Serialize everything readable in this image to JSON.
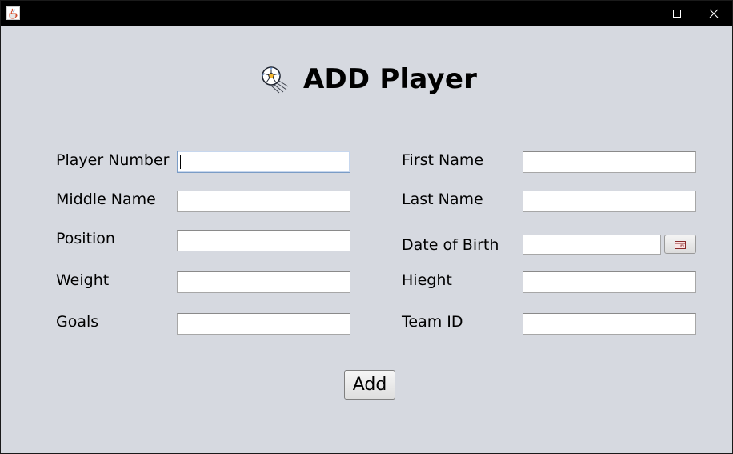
{
  "window": {
    "icons": {
      "app": "java-cup-icon",
      "minimize": "minimize-icon",
      "maximize": "maximize-icon",
      "close": "close-icon"
    }
  },
  "header": {
    "icon": "soccer-ball-icon",
    "title": "ADD Player"
  },
  "form": {
    "player_number": {
      "label": "Player Number",
      "value": ""
    },
    "first_name": {
      "label": "First Name",
      "value": ""
    },
    "middle_name": {
      "label": "Middle Name",
      "value": ""
    },
    "last_name": {
      "label": "Last Name",
      "value": ""
    },
    "position": {
      "label": "Position",
      "value": ""
    },
    "date_of_birth": {
      "label": "Date of Birth",
      "value": "",
      "button_icon": "calendar-icon"
    },
    "weight": {
      "label": "Weight",
      "value": ""
    },
    "height": {
      "label": "Hieght",
      "value": ""
    },
    "goals": {
      "label": "Goals",
      "value": ""
    },
    "team_id": {
      "label": "Team ID",
      "value": ""
    }
  },
  "actions": {
    "add_label": "Add"
  },
  "colors": {
    "background": "#d6d9e0",
    "titlebar": "#000000",
    "focus_border": "#7a9cc6"
  }
}
